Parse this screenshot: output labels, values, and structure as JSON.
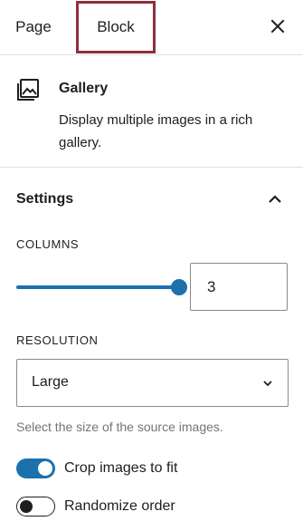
{
  "tabs": {
    "page": "Page",
    "block": "Block"
  },
  "block_card": {
    "title": "Gallery",
    "description": "Display multiple images in a rich gallery."
  },
  "settings": {
    "title": "Settings",
    "columns": {
      "label": "COLUMNS",
      "value": "3",
      "min": 1,
      "max": 3
    },
    "resolution": {
      "label": "RESOLUTION",
      "selected": "Large",
      "help": "Select the size of the source images."
    },
    "toggles": {
      "crop": {
        "label": "Crop images to fit",
        "on": true
      },
      "randomize": {
        "label": "Randomize order",
        "on": false
      }
    }
  },
  "colors": {
    "accent": "#1c71ad",
    "highlight_box": "#8f2f3f",
    "text": "#1e1e1e",
    "help_text": "#757575",
    "divider": "#e0e0e0"
  }
}
